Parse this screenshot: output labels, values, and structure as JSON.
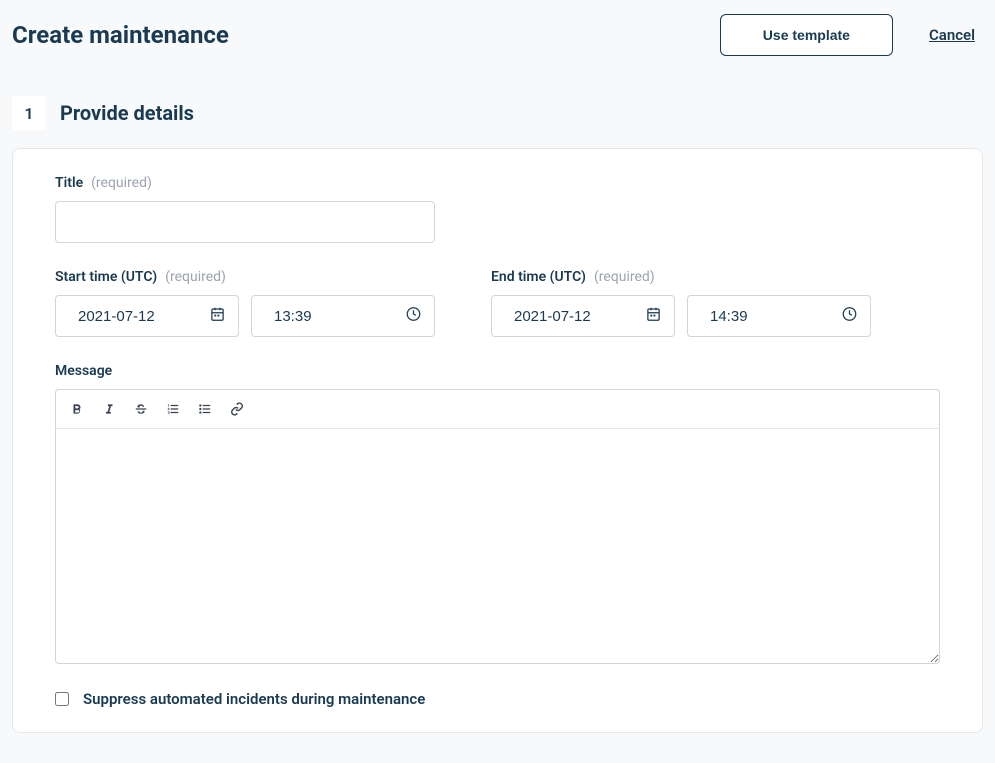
{
  "header": {
    "title": "Create maintenance",
    "use_template_label": "Use template",
    "cancel_label": "Cancel"
  },
  "step": {
    "number": "1",
    "title": "Provide details"
  },
  "form": {
    "title": {
      "label": "Title",
      "required_hint": "(required)",
      "value": ""
    },
    "start_time": {
      "label": "Start time (UTC)",
      "required_hint": "(required)",
      "date": "2021-07-12",
      "time": "13:39"
    },
    "end_time": {
      "label": "End time (UTC)",
      "required_hint": "(required)",
      "date": "2021-07-12",
      "time": "14:39"
    },
    "message": {
      "label": "Message",
      "value": ""
    },
    "suppress": {
      "label": "Suppress automated incidents during maintenance",
      "checked": false
    }
  }
}
